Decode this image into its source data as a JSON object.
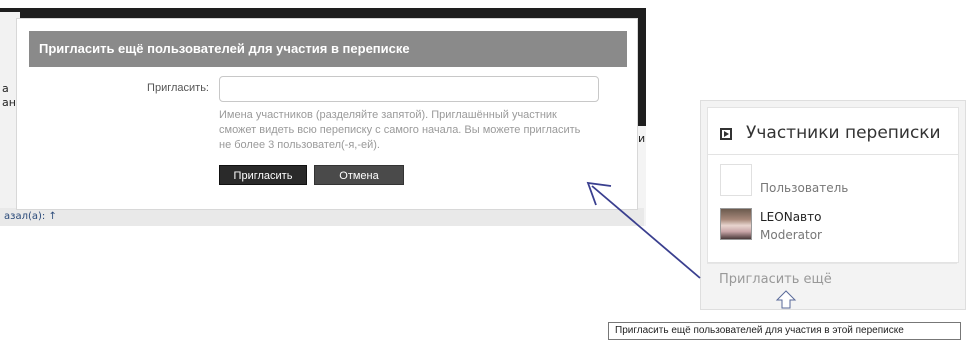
{
  "background_page": {
    "footer_fragment": "азал(а): ↑",
    "left_fragment_1": "а",
    "left_fragment_2": "ан",
    "right_fragment": "и"
  },
  "modal": {
    "title": "Пригласить ещё пользователей для участия в переписке",
    "invite_label": "Пригласить:",
    "invite_value": "",
    "hint": "Имена участников (разделяйте запятой). Приглашённый участник сможет видеть всю переписку с самого начала. Вы можете пригласить не более 3 пользовател(-я,-ей).",
    "invite_button": "Пригласить",
    "cancel_button": "Отмена"
  },
  "panel": {
    "title": "Участники переписки",
    "title_icon": "play-square-icon",
    "participants": [
      {
        "name": "",
        "role": "Пользователь",
        "avatar": "blank-avatar"
      },
      {
        "name": "LEONавто",
        "role": "Moderator",
        "avatar": "photo-avatar"
      }
    ],
    "invite_more": "Пригласить ещё"
  },
  "tooltip": {
    "text": "Пригласить ещё пользователей для участия в этой переписке"
  },
  "colors": {
    "modal_header": "#8a8a8a",
    "arrow": "#3a3f8f",
    "primary_button": "#2a2a2a"
  }
}
